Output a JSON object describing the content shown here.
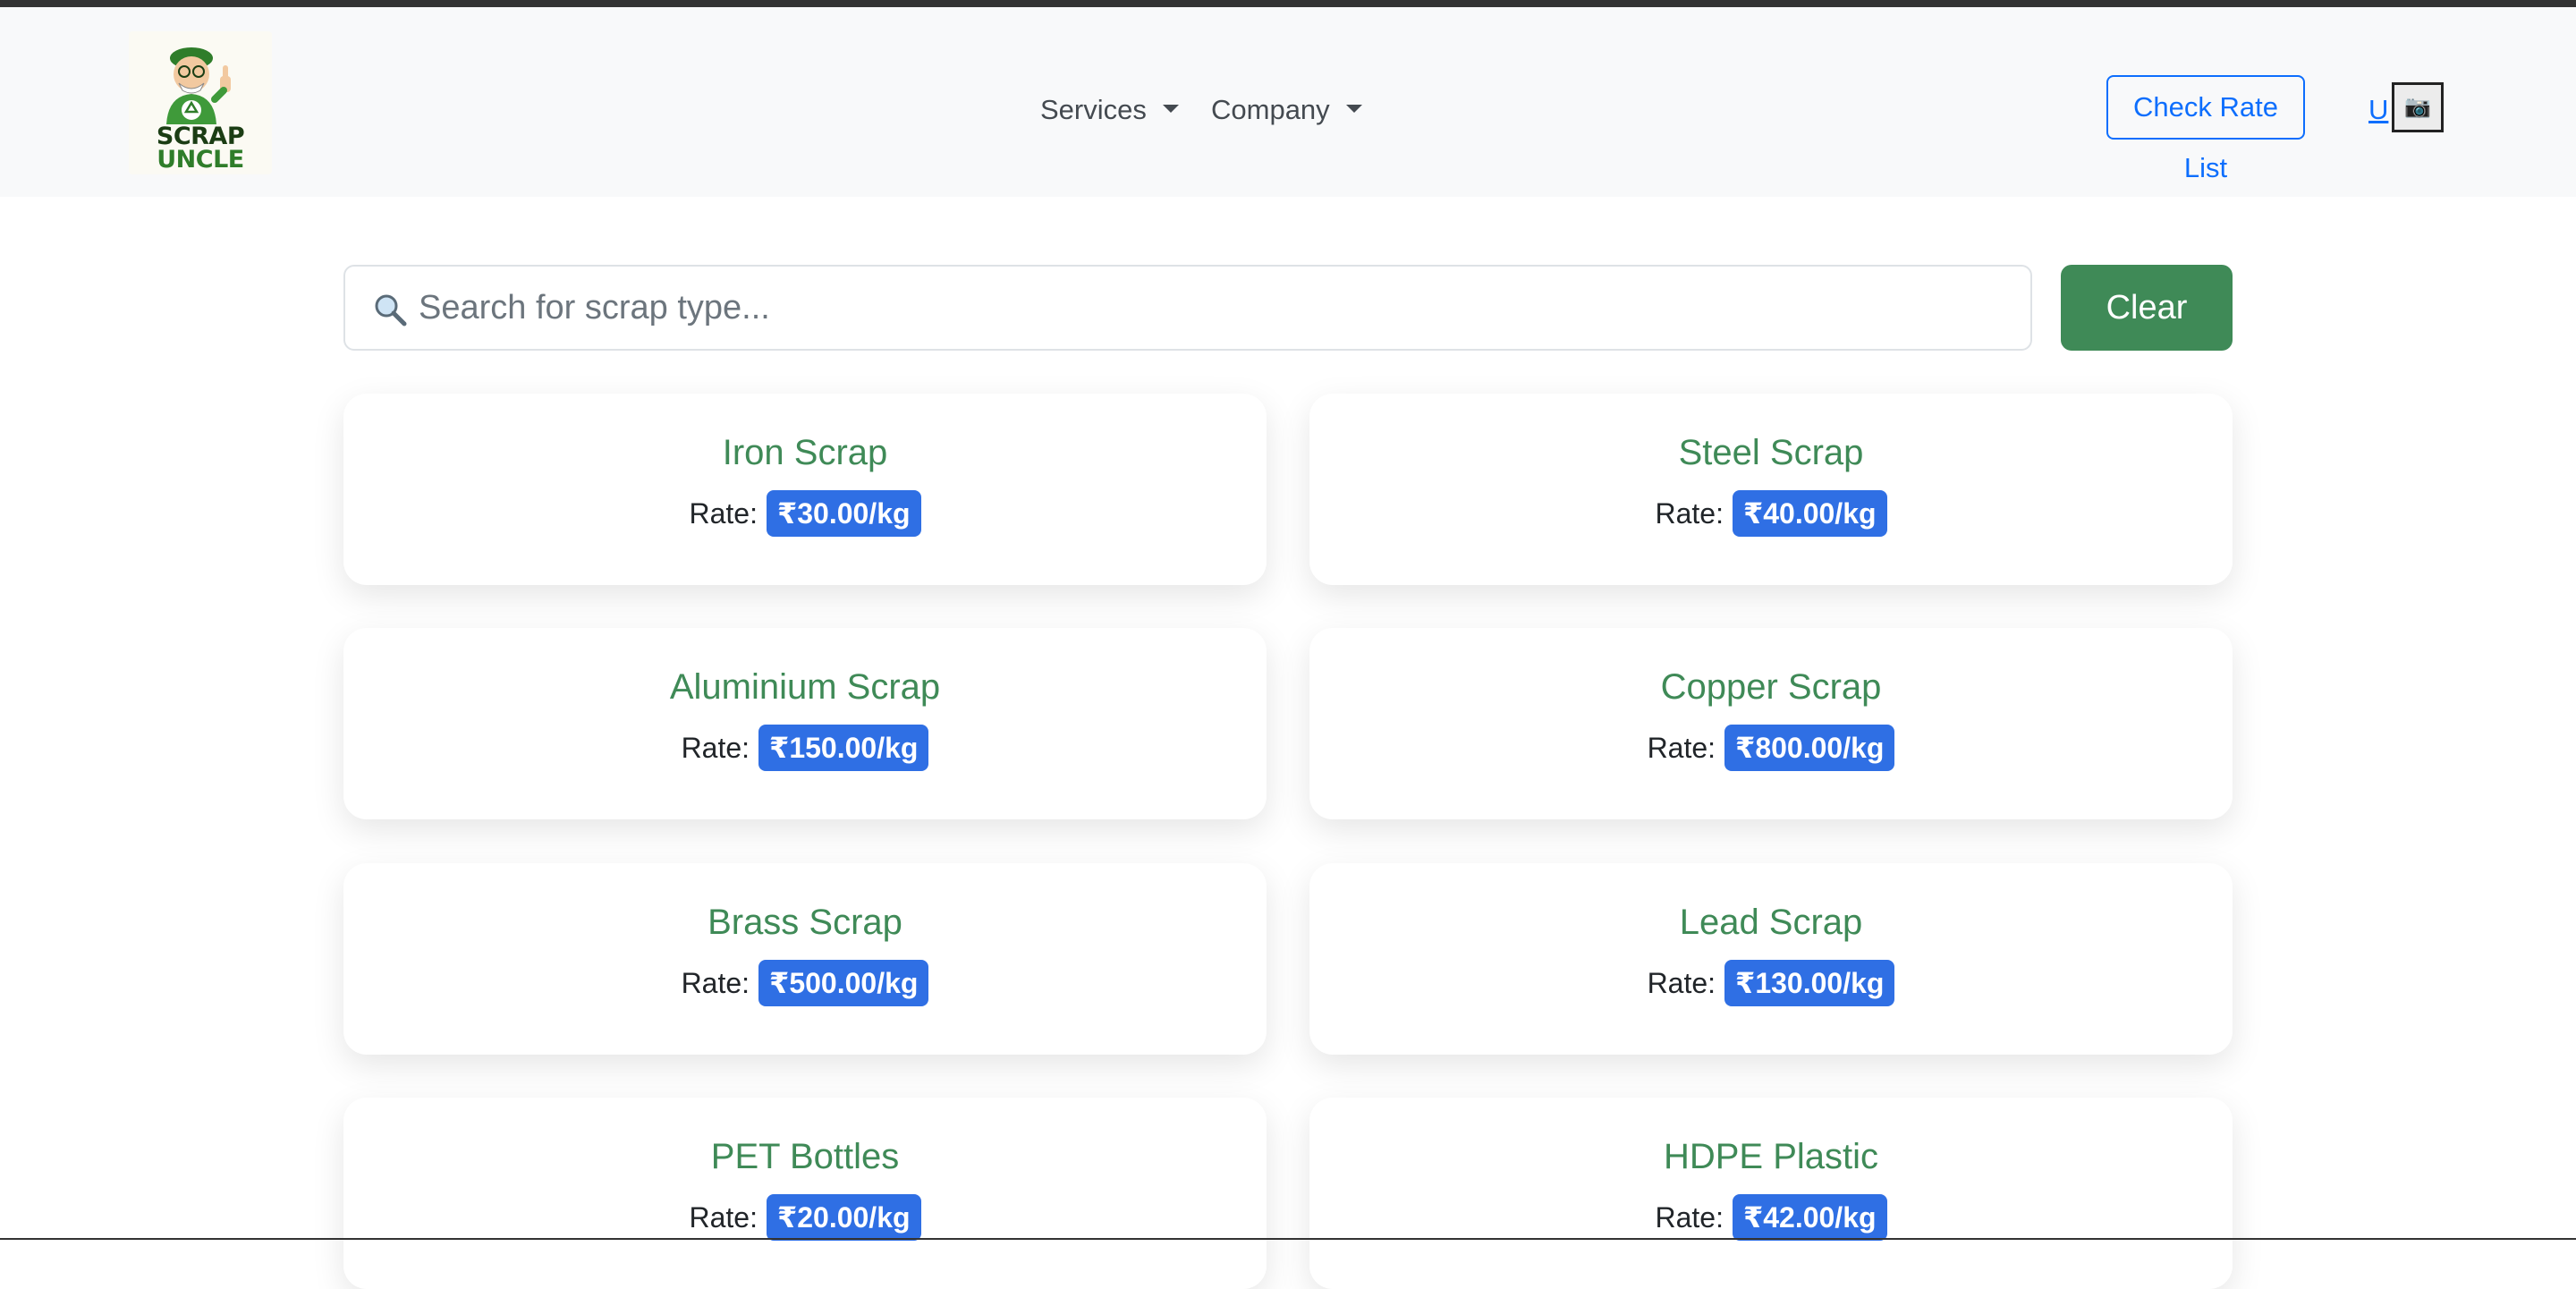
{
  "header": {
    "logo_line1": "SCRAP",
    "logo_line2": "UNCLE",
    "nav": [
      {
        "label": "Services"
      },
      {
        "label": "Company"
      }
    ],
    "check_rate_label": "Check Rate List",
    "user_link": "U",
    "user_photo_icon": "📷"
  },
  "search": {
    "placeholder": "Search for scrap type...",
    "value": "",
    "clear_label": "Clear"
  },
  "rate_label": "Rate:",
  "items": [
    {
      "name": "Iron Scrap",
      "rate": "₹30.00/kg"
    },
    {
      "name": "Steel Scrap",
      "rate": "₹40.00/kg"
    },
    {
      "name": "Aluminium Scrap",
      "rate": "₹150.00/kg"
    },
    {
      "name": "Copper Scrap",
      "rate": "₹800.00/kg"
    },
    {
      "name": "Brass Scrap",
      "rate": "₹500.00/kg"
    },
    {
      "name": "Lead Scrap",
      "rate": "₹130.00/kg"
    },
    {
      "name": "PET Bottles",
      "rate": "₹20.00/kg"
    },
    {
      "name": "HDPE Plastic",
      "rate": "₹42.00/kg"
    }
  ],
  "colors": {
    "brand_green": "#3f8a57",
    "badge_blue": "#2f6fe4",
    "link_blue": "#0d6efd",
    "navbar_bg": "#f8f9fa"
  }
}
